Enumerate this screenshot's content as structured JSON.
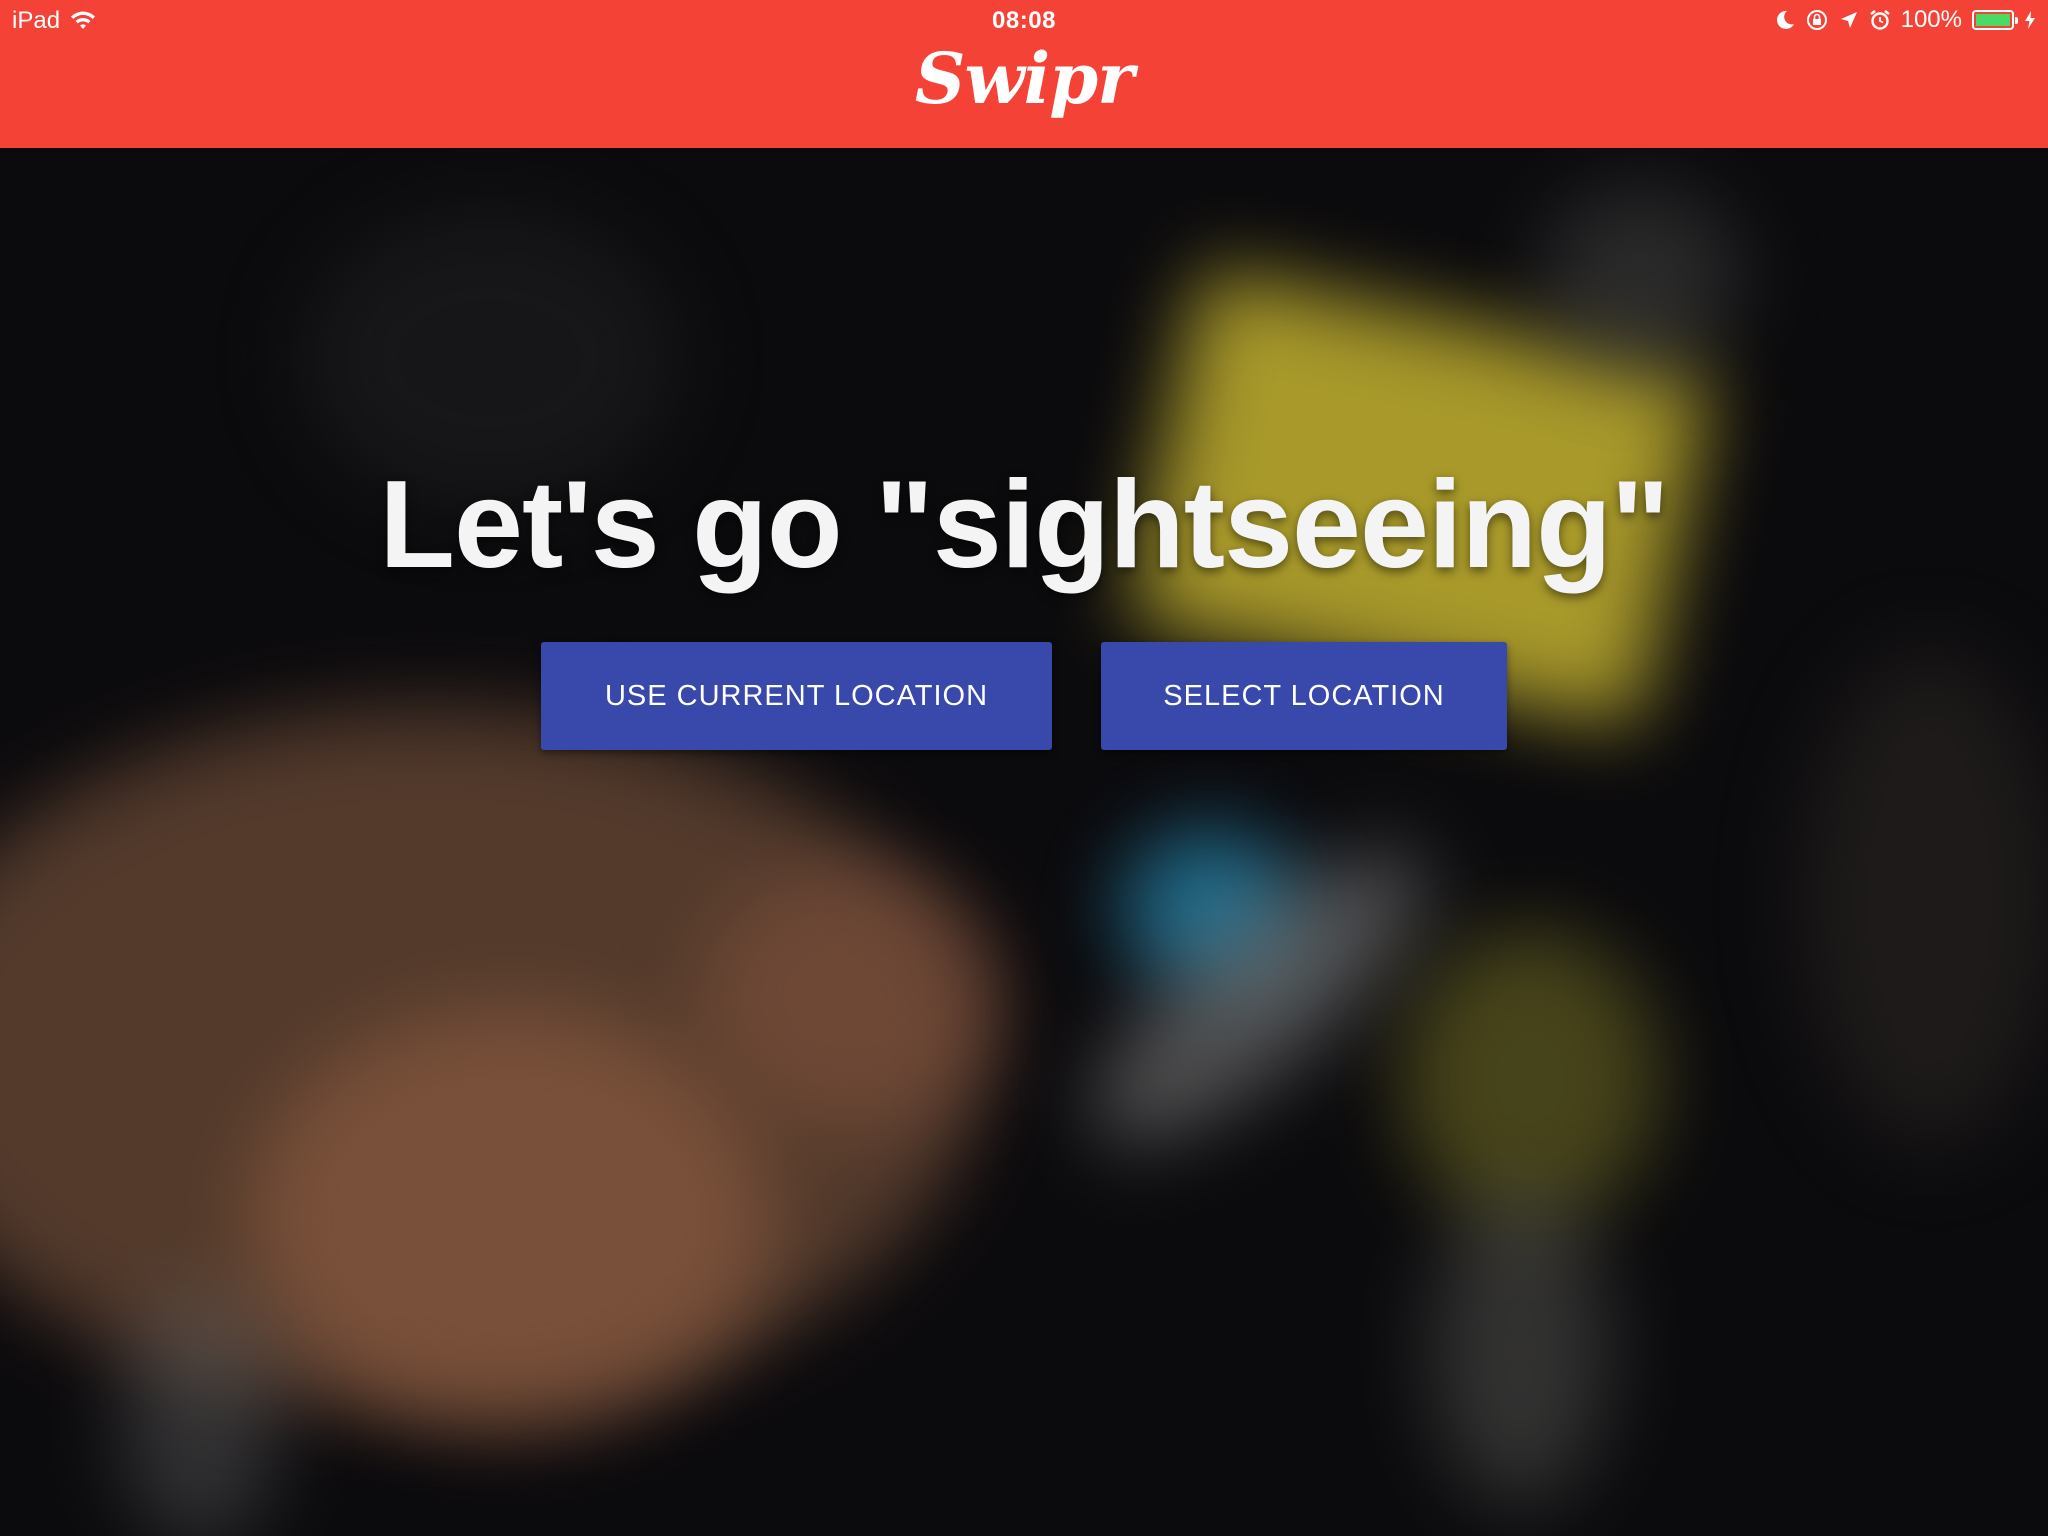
{
  "status_bar": {
    "device": "iPad",
    "time": "08:08",
    "battery": "100%",
    "battery_level": 1.0,
    "icons": [
      "wifi-icon",
      "moon-icon",
      "orientation-lock-icon",
      "location-arrow-icon",
      "alarm-icon",
      "battery-icon",
      "charging-bolt-icon"
    ]
  },
  "header": {
    "logo_text": "Swipr",
    "background_color": "#f44336"
  },
  "hero": {
    "title": "Let's go \"sightseeing\""
  },
  "actions": {
    "use_current_location": "USE CURRENT LOCATION",
    "select_location": "SELECT LOCATION",
    "button_color": "#3949ab"
  }
}
